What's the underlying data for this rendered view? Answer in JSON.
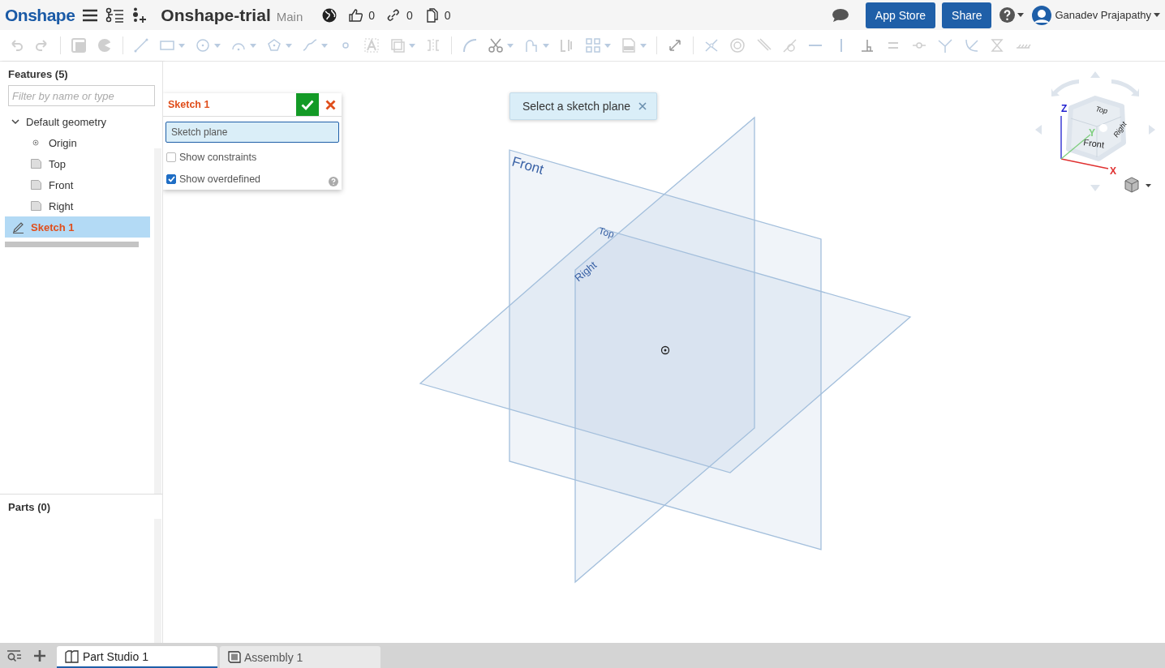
{
  "header": {
    "logo": "Onshape",
    "document_title": "Onshape-trial",
    "branch": "Main",
    "counters": [
      {
        "kind": "likes",
        "value": "0"
      },
      {
        "kind": "links",
        "value": "0"
      },
      {
        "kind": "copies",
        "value": "0"
      }
    ],
    "buttons": [
      "App Store",
      "Share"
    ],
    "user": "Ganadev Prajapathy"
  },
  "features": {
    "title": "Features (5)",
    "filter_placeholder": "Filter by name or type",
    "tree": [
      {
        "label": "Default geometry",
        "kind": "group",
        "expanded": true,
        "selected": false,
        "children": [
          {
            "label": "Origin",
            "kind": "point",
            "selected": false
          },
          {
            "label": "Top",
            "kind": "plane",
            "selected": false
          },
          {
            "label": "Front",
            "kind": "plane",
            "selected": false
          },
          {
            "label": "Right",
            "kind": "plane",
            "selected": false
          }
        ]
      },
      {
        "label": "Sketch 1",
        "kind": "sketch",
        "selected": true
      }
    ]
  },
  "parts": {
    "title": "Parts (0)"
  },
  "sketch_dialog": {
    "title": "Sketch 1",
    "field_value": "Sketch plane",
    "options": [
      {
        "label": "Show constraints",
        "checked": false
      },
      {
        "label": "Show overdefined",
        "checked": true
      }
    ]
  },
  "toast": {
    "text": "Select a sketch plane"
  },
  "viewport": {
    "planes": [
      {
        "kind": "front",
        "label": "Front"
      },
      {
        "kind": "top",
        "label": "Top"
      },
      {
        "kind": "right",
        "label": "Right"
      }
    ],
    "view_cube": {
      "faces": [
        {
          "kind": "top",
          "label": "Top"
        },
        {
          "kind": "front",
          "label": "Front"
        },
        {
          "kind": "right",
          "label": "Right"
        }
      ],
      "axes": [
        {
          "kind": "x",
          "label": "X"
        },
        {
          "kind": "y",
          "label": "Y"
        },
        {
          "kind": "z",
          "label": "Z"
        }
      ]
    }
  },
  "tabs": [
    {
      "label": "Part Studio 1",
      "kind": "part-studio",
      "selected": true
    },
    {
      "label": "Assembly 1",
      "kind": "assembly",
      "selected": false
    }
  ]
}
